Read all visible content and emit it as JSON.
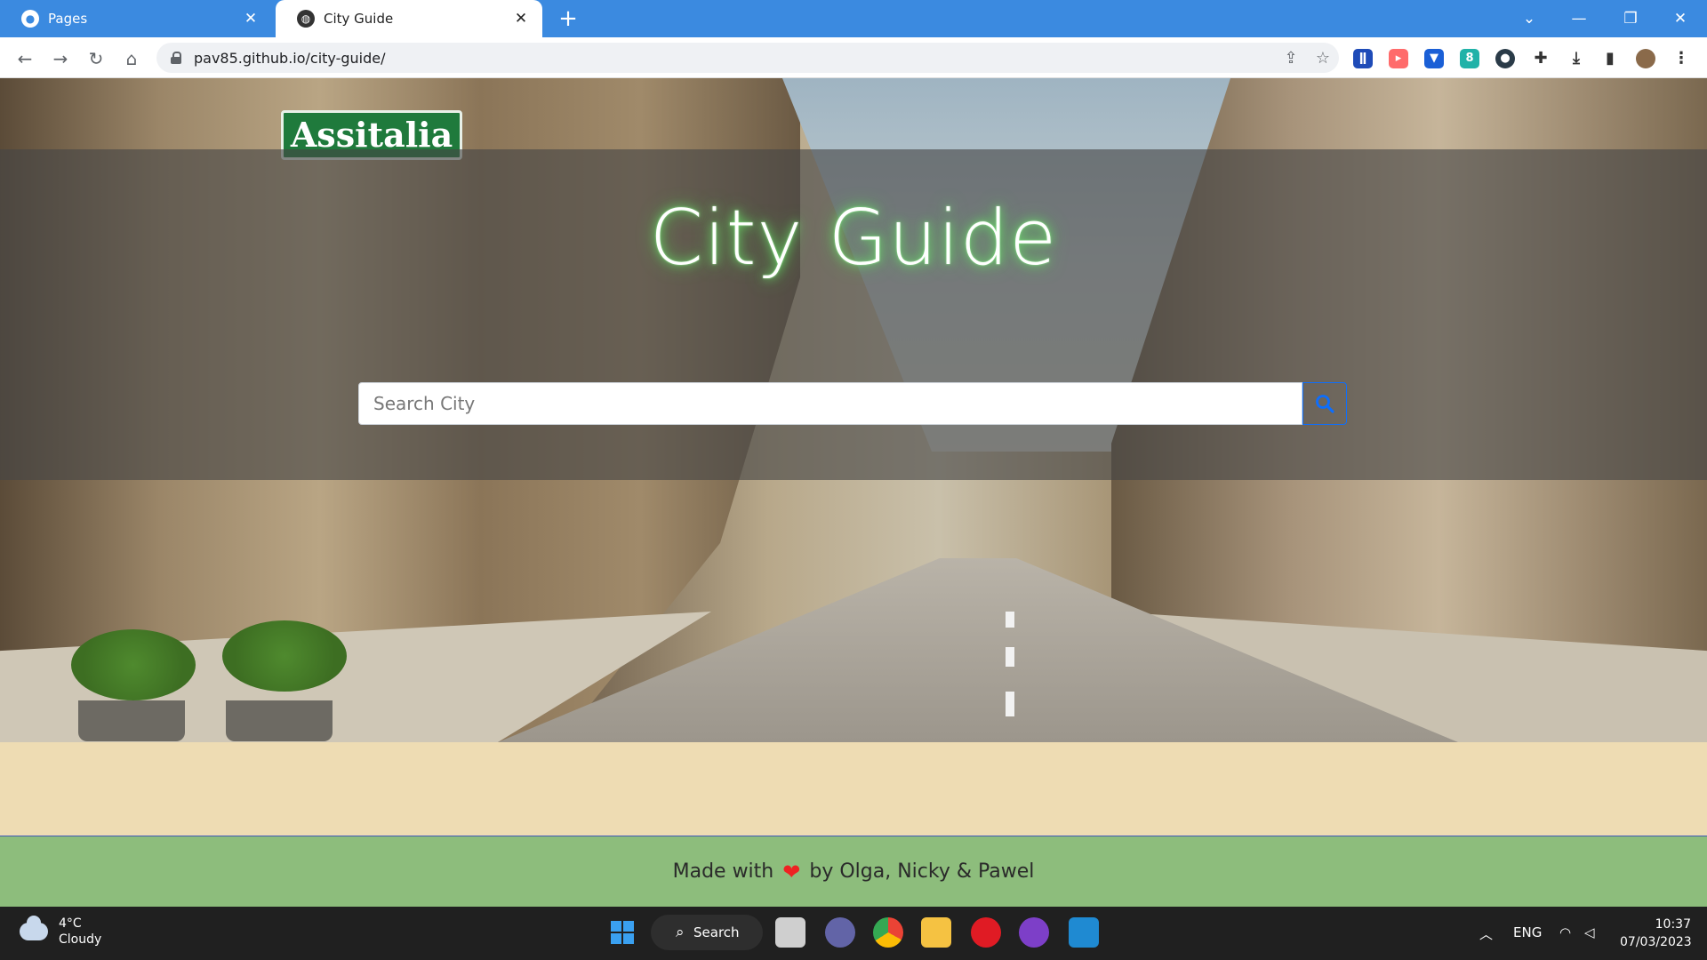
{
  "browser": {
    "tabs": [
      {
        "title": "Pages",
        "active": false
      },
      {
        "title": "City Guide",
        "active": true
      }
    ],
    "url": "pav85.github.io/city-guide/"
  },
  "page": {
    "hero_sign_text": "Assitalia",
    "title": "City Guide",
    "search": {
      "placeholder": "Search City",
      "value": ""
    },
    "footer": {
      "prefix": "Made with",
      "heart": "❤",
      "suffix": "by Olga, Nicky & Pawel"
    },
    "colors": {
      "content_bg": "#eedcb3",
      "footer_bg": "#8dbd7c",
      "title_glow": "#4cd84c",
      "search_button_border": "#0d6efd",
      "tab_strip": "#3b8ae0"
    }
  },
  "taskbar": {
    "weather": {
      "temp": "4°C",
      "condition": "Cloudy"
    },
    "search_label": "Search",
    "language": "ENG",
    "time": "10:37",
    "date": "07/03/2023"
  }
}
